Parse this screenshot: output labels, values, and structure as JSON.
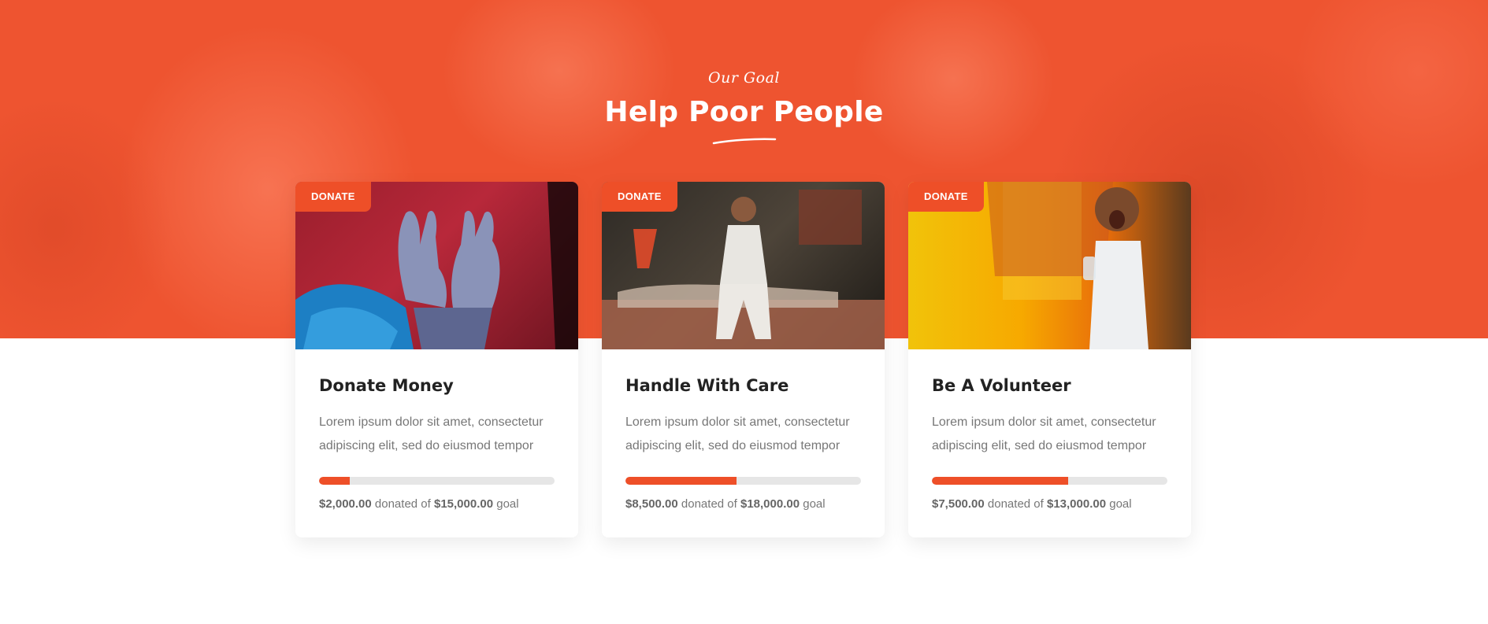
{
  "section": {
    "subtitle": "Our Goal",
    "title": "Help Poor People"
  },
  "colors": {
    "accent": "#ee4f28",
    "hero_bg": "#ee5430",
    "track": "#e6e6e6"
  },
  "cards": [
    {
      "badge": "DONATE",
      "title": "Donate Money",
      "description": "Lorem ipsum dolor sit amet, consectetur adipiscing elit, sed do eiusmod tempor",
      "raised": "$2,000.00",
      "donated_text": "donated of",
      "goal": "$15,000.00",
      "goal_text": "goal",
      "progress_percent": 13
    },
    {
      "badge": "DONATE",
      "title": "Handle With Care",
      "description": "Lorem ipsum dolor sit amet, consectetur adipiscing elit, sed do eiusmod tempor",
      "raised": "$8,500.00",
      "donated_text": "donated of",
      "goal": "$18,000.00",
      "goal_text": "goal",
      "progress_percent": 47
    },
    {
      "badge": "DONATE",
      "title": "Be A Volunteer",
      "description": "Lorem ipsum dolor sit amet, consectetur adipiscing elit, sed do eiusmod tempor",
      "raised": "$7,500.00",
      "donated_text": "donated of",
      "goal": "$13,000.00",
      "goal_text": "goal",
      "progress_percent": 58
    }
  ]
}
